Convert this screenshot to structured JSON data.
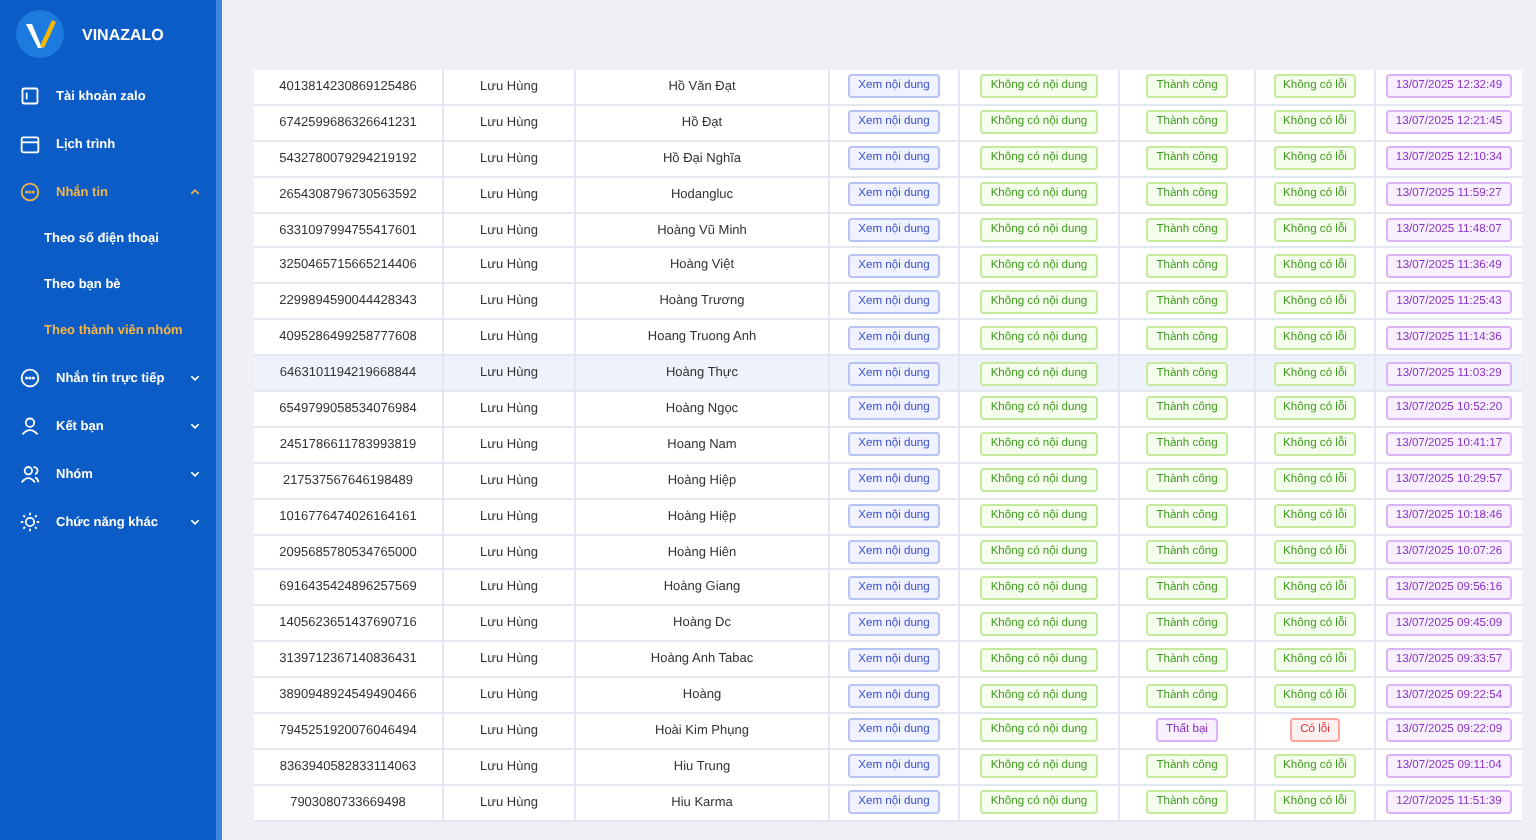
{
  "sidebar": {
    "brand": "VINAZALO",
    "items": [
      {
        "label": "Tài khoản zalo",
        "selected": false
      },
      {
        "label": "Lịch trình",
        "selected": false
      },
      {
        "label": "Nhắn tin",
        "selected": true,
        "expanded": true,
        "children": [
          {
            "label": "Theo số điện thoại",
            "selected": false
          },
          {
            "label": "Theo bạn bè",
            "selected": false
          },
          {
            "label": "Theo thành viên nhóm",
            "selected": true
          }
        ]
      },
      {
        "label": "Nhắn tin trực tiếp",
        "selected": false,
        "expanded": false
      },
      {
        "label": "Kết bạn",
        "selected": false,
        "expanded": false
      },
      {
        "label": "Nhóm",
        "selected": false,
        "expanded": false
      },
      {
        "label": "Chức năng khác",
        "selected": false,
        "expanded": false
      }
    ]
  },
  "table": {
    "rows": [
      {
        "id": "4013814230869125486",
        "sender": "Lưu Hùng",
        "name": "Hồ Văn Đạt",
        "view": "Xem nội dung",
        "content": "Không có nội dung",
        "status": "Thành công",
        "error": "Không có lỗi",
        "failed": false,
        "time": "13/07/2025 12:32:49",
        "selected": false
      },
      {
        "id": "6742599686326641231",
        "sender": "Lưu Hùng",
        "name": "Hồ Đạt",
        "view": "Xem nội dung",
        "content": "Không có nội dung",
        "status": "Thành công",
        "error": "Không có lỗi",
        "failed": false,
        "time": "13/07/2025 12:21:45",
        "selected": false
      },
      {
        "id": "5432780079294219192",
        "sender": "Lưu Hùng",
        "name": "Hồ Đại Nghĩa",
        "view": "Xem nội dung",
        "content": "Không có nội dung",
        "status": "Thành công",
        "error": "Không có lỗi",
        "failed": false,
        "time": "13/07/2025 12:10:34",
        "selected": false
      },
      {
        "id": "2654308796730563592",
        "sender": "Lưu Hùng",
        "name": "Hodangluc",
        "view": "Xem nội dung",
        "content": "Không có nội dung",
        "status": "Thành công",
        "error": "Không có lỗi",
        "failed": false,
        "time": "13/07/2025 11:59:27",
        "selected": false
      },
      {
        "id": "6331097994755417601",
        "sender": "Lưu Hùng",
        "name": "Hoàng Vũ Minh",
        "view": "Xem nội dung",
        "content": "Không có nội dung",
        "status": "Thành công",
        "error": "Không có lỗi",
        "failed": false,
        "time": "13/07/2025 11:48:07",
        "selected": false
      },
      {
        "id": "3250465715665214406",
        "sender": "Lưu Hùng",
        "name": "Hoàng Việt",
        "view": "Xem nội dung",
        "content": "Không có nội dung",
        "status": "Thành công",
        "error": "Không có lỗi",
        "failed": false,
        "time": "13/07/2025 11:36:49",
        "selected": false
      },
      {
        "id": "2299894590044428343",
        "sender": "Lưu Hùng",
        "name": "Hoàng Trương",
        "view": "Xem nội dung",
        "content": "Không có nội dung",
        "status": "Thành công",
        "error": "Không có lỗi",
        "failed": false,
        "time": "13/07/2025 11:25:43",
        "selected": false
      },
      {
        "id": "4095286499258777608",
        "sender": "Lưu Hùng",
        "name": "Hoang Truong Anh",
        "view": "Xem nội dung",
        "content": "Không có nội dung",
        "status": "Thành công",
        "error": "Không có lỗi",
        "failed": false,
        "time": "13/07/2025 11:14:36",
        "selected": false
      },
      {
        "id": "6463101194219668844",
        "sender": "Lưu Hùng",
        "name": "Hoàng Thực",
        "view": "Xem nội dung",
        "content": "Không có nội dung",
        "status": "Thành công",
        "error": "Không có lỗi",
        "failed": false,
        "time": "13/07/2025 11:03:29",
        "selected": true
      },
      {
        "id": "6549799058534076984",
        "sender": "Lưu Hùng",
        "name": "Hoàng Ngọc",
        "view": "Xem nội dung",
        "content": "Không có nội dung",
        "status": "Thành công",
        "error": "Không có lỗi",
        "failed": false,
        "time": "13/07/2025 10:52:20",
        "selected": false
      },
      {
        "id": "2451786611783993819",
        "sender": "Lưu Hùng",
        "name": "Hoang Nam",
        "view": "Xem nội dung",
        "content": "Không có nội dung",
        "status": "Thành công",
        "error": "Không có lỗi",
        "failed": false,
        "time": "13/07/2025 10:41:17",
        "selected": false
      },
      {
        "id": "217537567646198489",
        "sender": "Lưu Hùng",
        "name": "Hoàng Hiệp",
        "view": "Xem nội dung",
        "content": "Không có nội dung",
        "status": "Thành công",
        "error": "Không có lỗi",
        "failed": false,
        "time": "13/07/2025 10:29:57",
        "selected": false
      },
      {
        "id": "1016776474026164161",
        "sender": "Lưu Hùng",
        "name": "Hoàng Hiệp",
        "view": "Xem nội dung",
        "content": "Không có nội dung",
        "status": "Thành công",
        "error": "Không có lỗi",
        "failed": false,
        "time": "13/07/2025 10:18:46",
        "selected": false
      },
      {
        "id": "2095685780534765000",
        "sender": "Lưu Hùng",
        "name": "Hoàng Hiên",
        "view": "Xem nội dung",
        "content": "Không có nội dung",
        "status": "Thành công",
        "error": "Không có lỗi",
        "failed": false,
        "time": "13/07/2025 10:07:26",
        "selected": false
      },
      {
        "id": "6916435424896257569",
        "sender": "Lưu Hùng",
        "name": "Hoàng Giang",
        "view": "Xem nội dung",
        "content": "Không có nội dung",
        "status": "Thành công",
        "error": "Không có lỗi",
        "failed": false,
        "time": "13/07/2025 09:56:16",
        "selected": false
      },
      {
        "id": "1405623651437690716",
        "sender": "Lưu Hùng",
        "name": "Hoàng Dc",
        "view": "Xem nội dung",
        "content": "Không có nội dung",
        "status": "Thành công",
        "error": "Không có lỗi",
        "failed": false,
        "time": "13/07/2025 09:45:09",
        "selected": false
      },
      {
        "id": "3139712367140836431",
        "sender": "Lưu Hùng",
        "name": "Hoàng Anh Tabac",
        "view": "Xem nội dung",
        "content": "Không có nội dung",
        "status": "Thành công",
        "error": "Không có lỗi",
        "failed": false,
        "time": "13/07/2025 09:33:57",
        "selected": false
      },
      {
        "id": "3890948924549490466",
        "sender": "Lưu Hùng",
        "name": "Hoàng",
        "view": "Xem nội dung",
        "content": "Không có nội dung",
        "status": "Thành công",
        "error": "Không có lỗi",
        "failed": false,
        "time": "13/07/2025 09:22:54",
        "selected": false
      },
      {
        "id": "7945251920076046494",
        "sender": "Lưu Hùng",
        "name": "Hoài Kim Phụng",
        "view": "Xem nội dung",
        "content": "Không có nội dung",
        "status": "Thất bại",
        "error": "Có lỗi",
        "failed": true,
        "time": "13/07/2025 09:22:09",
        "selected": false
      },
      {
        "id": "8363940582833114063",
        "sender": "Lưu Hùng",
        "name": "Hiu Trung",
        "view": "Xem nội dung",
        "content": "Không có nội dung",
        "status": "Thành công",
        "error": "Không có lỗi",
        "failed": false,
        "time": "13/07/2025 09:11:04",
        "selected": false
      },
      {
        "id": "7903080733669498",
        "sender": "Lưu Hùng",
        "name": "Hiu Karma",
        "view": "Xem nội dung",
        "content": "Không có nội dung",
        "status": "Thành công",
        "error": "Không có lỗi",
        "failed": false,
        "time": "12/07/2025 11:51:39",
        "selected": false
      }
    ]
  }
}
